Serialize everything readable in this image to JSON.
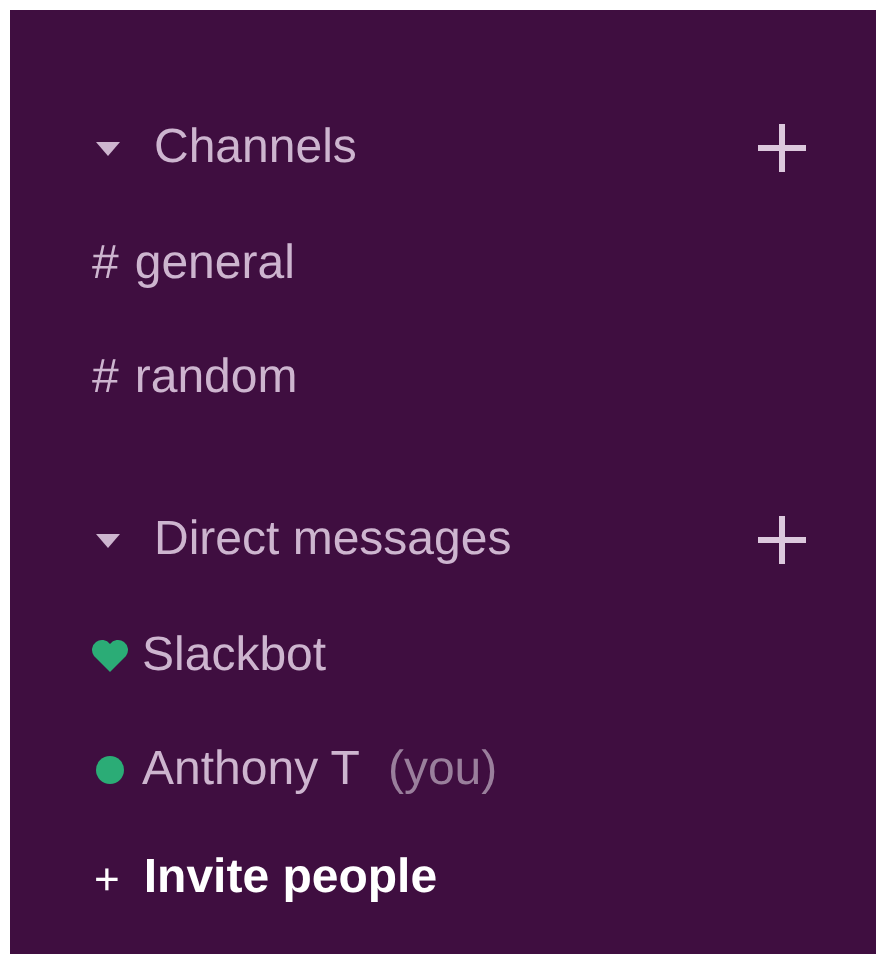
{
  "sections": [
    {
      "title": "Channels",
      "expanded": true,
      "items": [
        {
          "kind": "channel",
          "prefix": "#",
          "name": "general"
        },
        {
          "kind": "channel",
          "prefix": "#",
          "name": "random"
        }
      ]
    },
    {
      "title": "Direct messages",
      "expanded": true,
      "items": [
        {
          "kind": "heart",
          "name": "Slackbot",
          "color": "#2bac76"
        },
        {
          "kind": "dot",
          "name": "Anthony T",
          "suffix": "(you)",
          "color": "#2bac76"
        }
      ]
    }
  ],
  "invite": {
    "prefix": "+",
    "label": "Invite people"
  }
}
